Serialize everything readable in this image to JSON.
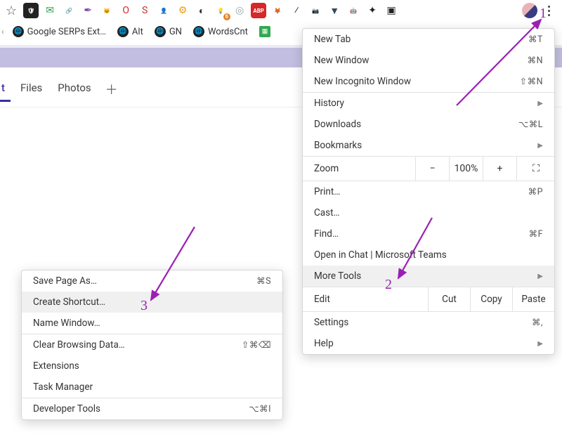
{
  "toolbar": {
    "extension_icons": [
      {
        "name": "shield-icon",
        "glyph": "🛡",
        "bg": "#222",
        "color": "#fff"
      },
      {
        "name": "mail-icon",
        "glyph": "✉",
        "bg": "#fff",
        "color": "#2a9d4a"
      },
      {
        "name": "link-icon",
        "glyph": "🔗",
        "bg": "#fff",
        "color": "#68a3d6"
      },
      {
        "name": "feather-icon",
        "glyph": "✒",
        "bg": "#fff",
        "color": "#7b3fa0"
      },
      {
        "name": "cat-icon",
        "glyph": "🐱",
        "bg": "#fff",
        "color": "#333"
      },
      {
        "name": "opera-icon",
        "glyph": "O",
        "bg": "#fff",
        "color": "#d62828"
      },
      {
        "name": "seo-icon",
        "glyph": "S",
        "bg": "#fff",
        "color": "#c0392b"
      },
      {
        "name": "person-icon",
        "glyph": "👤",
        "bg": "#fff",
        "color": "#e67e22"
      },
      {
        "name": "gear-icon",
        "glyph": "⚙",
        "bg": "#fff",
        "color": "#f39c12"
      },
      {
        "name": "similarweb-icon",
        "glyph": "◐",
        "bg": "#fff",
        "color": "#333"
      },
      {
        "name": "bulb-icon",
        "glyph": "💡",
        "bg": "#fff",
        "color": "#e1b12c",
        "badge": "6"
      },
      {
        "name": "privacy-icon",
        "glyph": "◎",
        "bg": "#fff",
        "color": "#95a5a6"
      },
      {
        "name": "adblock-icon",
        "glyph": "ABP",
        "bg": "#d62828",
        "color": "#fff"
      },
      {
        "name": "metamask-icon",
        "glyph": "🦊",
        "bg": "#fff",
        "color": "#e67e22"
      },
      {
        "name": "pipette-icon",
        "glyph": "⁄",
        "bg": "#fff",
        "color": "#222"
      },
      {
        "name": "camera-icon",
        "glyph": "📷",
        "bg": "#fff",
        "color": "#666"
      },
      {
        "name": "vue-icon",
        "glyph": "▼",
        "bg": "#fff",
        "color": "#35495e"
      },
      {
        "name": "robot-icon",
        "glyph": "🤖",
        "bg": "#fff",
        "color": "#e67e22"
      },
      {
        "name": "puzzle-icon",
        "glyph": "✦",
        "bg": "#fff",
        "color": "#222"
      },
      {
        "name": "device-icon",
        "glyph": "▣",
        "bg": "#fff",
        "color": "#222"
      }
    ]
  },
  "bookmarks": [
    {
      "icon": "globe",
      "label": "Google SERPs Ext…"
    },
    {
      "icon": "globe",
      "label": "Alt"
    },
    {
      "icon": "globe",
      "label": "GN"
    },
    {
      "icon": "globe",
      "label": "WordsCnt"
    },
    {
      "icon": "sheets",
      "label": ""
    }
  ],
  "page_tabs": {
    "items": [
      "t",
      "Files",
      "Photos"
    ],
    "active_index": 0
  },
  "main_menu": {
    "new_tab": "New Tab",
    "new_tab_sc": "⌘T",
    "new_window": "New Window",
    "new_window_sc": "⌘N",
    "new_incognito": "New Incognito Window",
    "new_incognito_sc": "⇧⌘N",
    "history": "History",
    "downloads": "Downloads",
    "downloads_sc": "⌥⌘L",
    "bookmarks": "Bookmarks",
    "zoom": "Zoom",
    "zoom_minus": "−",
    "zoom_val": "100%",
    "zoom_plus": "+",
    "print": "Print…",
    "print_sc": "⌘P",
    "cast": "Cast…",
    "find": "Find…",
    "find_sc": "⌘F",
    "open_in_chat": "Open in Chat | Microsoft Teams",
    "more_tools": "More Tools",
    "edit": "Edit",
    "cut": "Cut",
    "copy": "Copy",
    "paste": "Paste",
    "settings": "Settings",
    "settings_sc": "⌘,",
    "help": "Help"
  },
  "sub_menu": {
    "save_page": "Save Page As…",
    "save_page_sc": "⌘S",
    "create_shortcut": "Create Shortcut…",
    "name_window": "Name Window…",
    "clear_data": "Clear Browsing Data…",
    "clear_data_sc": "⇧⌘⌫",
    "extensions": "Extensions",
    "task_manager": "Task Manager",
    "dev_tools": "Developer Tools",
    "dev_tools_sc": "⌥⌘I"
  },
  "annotations": {
    "n1": "1",
    "n2": "2",
    "n3": "3"
  }
}
